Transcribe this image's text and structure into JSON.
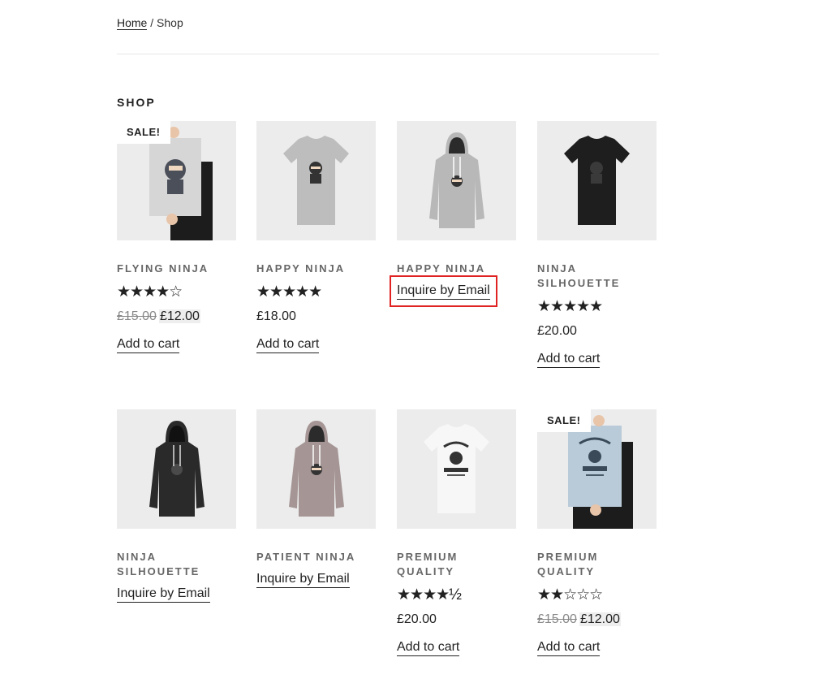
{
  "breadcrumb": {
    "home": "Home",
    "separator": " / ",
    "current": "Shop"
  },
  "page_title": "SHOP",
  "products": [
    {
      "name": "FLYING NINJA",
      "sale_badge": "SALE!",
      "rating_stars": "★★★★☆",
      "rating": 4,
      "old_price": "£15.00",
      "price": "£12.00",
      "action": "Add to cart",
      "image": "ninja-poster"
    },
    {
      "name": "HAPPY NINJA",
      "rating_stars": "★★★★★",
      "rating": 5,
      "price": "£18.00",
      "action": "Add to cart",
      "image": "grey-tshirt"
    },
    {
      "name": "HAPPY NINJA",
      "action": "Inquire by Email",
      "image": "grey-hoodie"
    },
    {
      "name": "NINJA SILHOUETTE",
      "rating_stars": "★★★★★",
      "rating": 5,
      "price": "£20.00",
      "action": "Add to cart",
      "image": "black-tshirt"
    },
    {
      "name": "NINJA SILHOUETTE",
      "action": "Inquire by Email",
      "image": "black-hoodie"
    },
    {
      "name": "PATIENT NINJA",
      "action": "Inquire by Email",
      "image": "pink-hoodie"
    },
    {
      "name": "PREMIUM QUALITY",
      "rating_stars": "★★★★½",
      "rating": 4.5,
      "price": "£20.00",
      "action": "Add to cart",
      "image": "white-tshirt"
    },
    {
      "name": "PREMIUM QUALITY",
      "sale_badge": "SALE!",
      "rating_stars": "★★☆☆☆",
      "rating": 2,
      "old_price": "£15.00",
      "price": "£12.00",
      "action": "Add to cart",
      "image": "woothemes-poster"
    }
  ],
  "colors": {
    "accent_highlight": "#e02222",
    "thumb_bg": "#ececec"
  }
}
